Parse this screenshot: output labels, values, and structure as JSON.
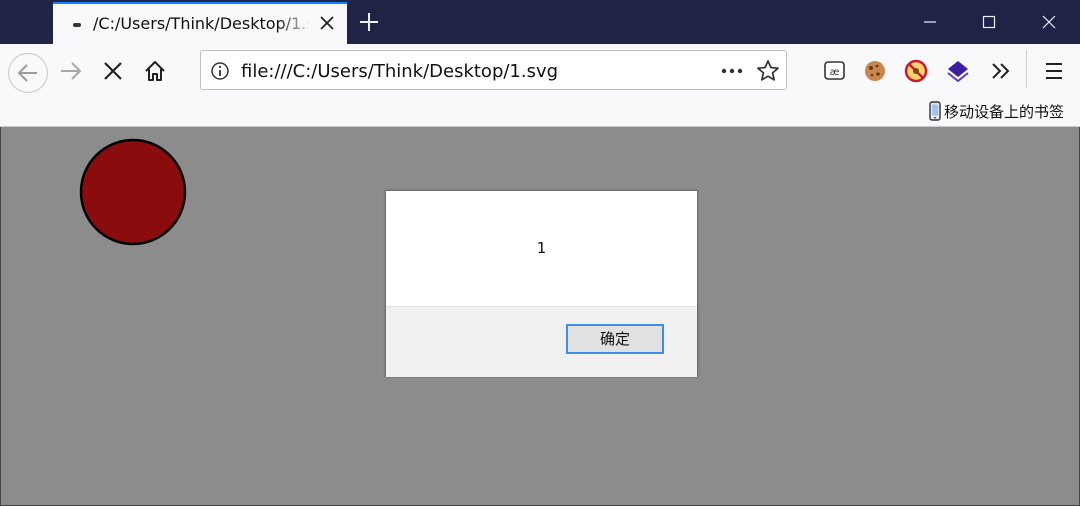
{
  "browser": {
    "tab": {
      "title": "/C:/Users/Think/Desktop/1.svg",
      "favicon": "page-icon",
      "close_icon": "close-icon"
    },
    "new_tab_icon": "plus-icon",
    "window_controls": [
      "minimize-icon",
      "maximize-icon",
      "close-icon"
    ],
    "nav": {
      "back_icon": "back-arrow-icon",
      "forward_icon": "forward-arrow-icon",
      "stop_icon": "stop-icon",
      "home_icon": "home-icon"
    },
    "url": {
      "info_icon": "info-icon",
      "text": "file:///C:/Users/Think/Desktop/1.svg",
      "more_icon": "more-dots-icon",
      "bookmark_icon": "star-icon"
    },
    "toolbar_icons": [
      "extension-ae-icon",
      "cookie-icon",
      "blocker-icon",
      "layers-icon",
      "overflow-chevron-icon",
      "menu-hamburger-icon"
    ],
    "bookmarks": {
      "mobile_label": "移动设备上的书签",
      "mobile_icon": "mobile-phone-icon"
    }
  },
  "page": {
    "circle": {
      "fill": "#8b0c0c",
      "stroke": "#000000"
    },
    "background": "#8c8c8c"
  },
  "dialog": {
    "message": "1",
    "ok_label": "确定"
  }
}
